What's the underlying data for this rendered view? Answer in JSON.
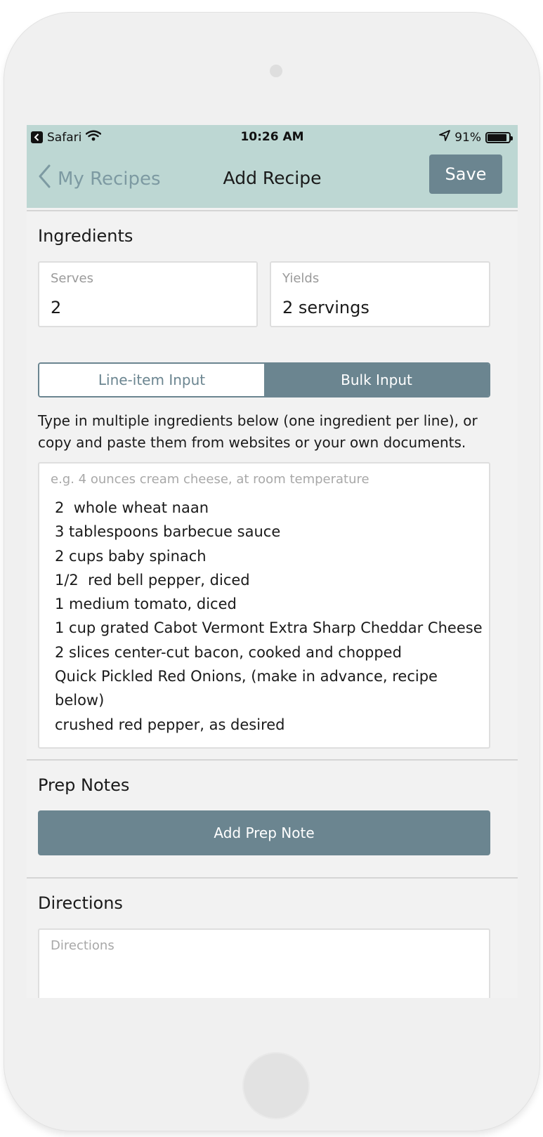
{
  "status_bar": {
    "back_app": "Safari",
    "time": "10:26 AM",
    "battery": "91%",
    "battery_level": 0.91,
    "icons": [
      "back-icon",
      "wifi-icon",
      "location-arrow-icon",
      "battery-icon"
    ]
  },
  "nav": {
    "back_label": "My Recipes",
    "title": "Add Recipe",
    "save_label": "Save"
  },
  "ingredients": {
    "section_title": "Ingredients",
    "serves_label": "Serves",
    "serves_value": "2",
    "yields_label": "Yields",
    "yields_value": "2 servings",
    "tabs": [
      {
        "label": "Line-item Input",
        "active": false
      },
      {
        "label": "Bulk Input",
        "active": true
      }
    ],
    "help_text": "Type in multiple ingredients below (one ingredient per line), or copy and paste them from websites or your own documents.",
    "bulk_placeholder": "e.g. 4 ounces cream cheese, at room temperature",
    "lines": [
      "2  whole wheat naan",
      "3 tablespoons barbecue sauce",
      "2 cups baby spinach",
      "1/2  red bell pepper, diced",
      "1 medium tomato, diced",
      "1 cup grated Cabot Vermont Extra Sharp Cheddar Cheese",
      "2 slices center-cut bacon, cooked and chopped",
      "Quick Pickled Red Onions, (make in advance, recipe below)",
      "crushed red pepper, as desired"
    ]
  },
  "prep_notes": {
    "section_title": "Prep Notes",
    "button_label": "Add Prep Note"
  },
  "directions": {
    "section_title": "Directions",
    "placeholder": "Directions"
  },
  "colors": {
    "header_bg": "#bdd7d3",
    "accent": "#6b8590",
    "back_text": "#7d9aa2",
    "screen_bg": "#f2f2f2"
  }
}
